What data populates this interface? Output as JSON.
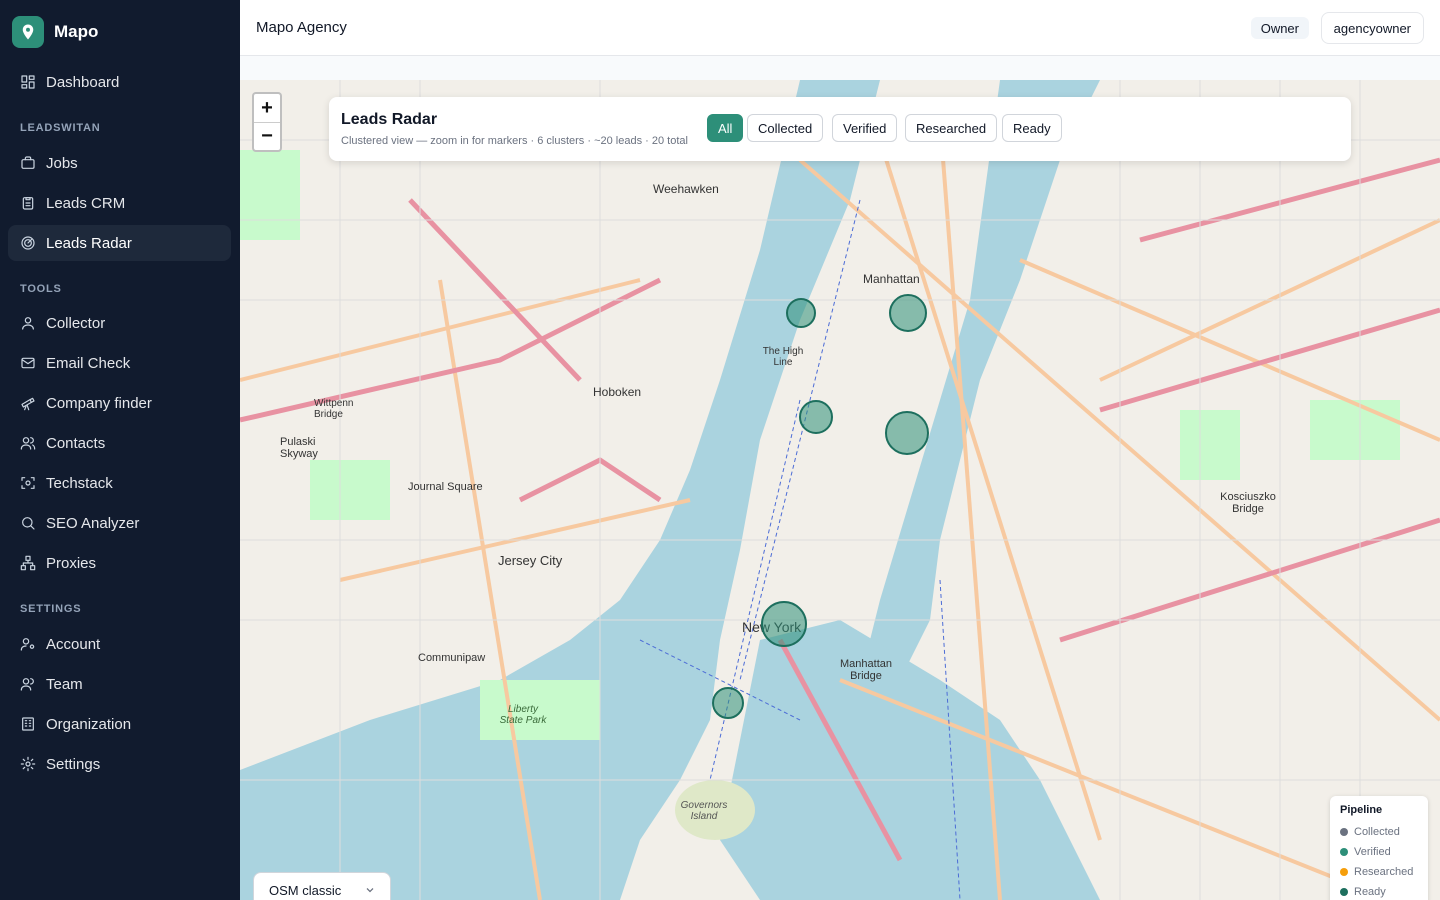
{
  "brand": {
    "name": "Mapo"
  },
  "sidebar": {
    "dashboard": "Dashboard",
    "section_leadswitan": "LEADSWITAN",
    "jobs": "Jobs",
    "leads_crm": "Leads CRM",
    "leads_radar": "Leads Radar",
    "section_tools": "TOOLS",
    "collector": "Collector",
    "email_check": "Email Check",
    "company_finder": "Company finder",
    "contacts": "Contacts",
    "techstack": "Techstack",
    "seo_analyzer": "SEO Analyzer",
    "proxies": "Proxies",
    "section_settings": "SETTINGS",
    "account": "Account",
    "team": "Team",
    "organization": "Organization",
    "settings": "Settings"
  },
  "header": {
    "agency": "Mapo Agency",
    "role": "Owner",
    "user": "agencyowner"
  },
  "radar": {
    "title": "Leads Radar",
    "subtitle": "Clustered view — zoom in for markers · 6 clusters · ~20 leads · 20 total",
    "filters": {
      "all": "All",
      "collected": "Collected",
      "verified": "Verified",
      "researched": "Researched",
      "ready": "Ready"
    }
  },
  "zoom": {
    "in": "+",
    "out": "−"
  },
  "legend": {
    "title": "Pipeline",
    "collected": "Collected",
    "verified": "Verified",
    "researched": "Researched",
    "ready": "Ready",
    "colors": {
      "collected": "#6b7280",
      "verified": "#2d8f79",
      "researched": "#f59e0b",
      "ready": "#1d6f5e"
    }
  },
  "map_labels": {
    "weehawken": "Weehawken",
    "manhattan": "Manhattan",
    "hoboken": "Hoboken",
    "jersey_city": "Jersey City",
    "journal_square": "Journal Square",
    "new_york": "New York",
    "communipaw": "Communipaw",
    "manhattan_bridge": "Manhattan Bridge",
    "kosciuszko_bridge": "Kosciuszko Bridge",
    "governors_island": "Governors Island",
    "liberty_state_park": "Liberty State Park",
    "pulaski_skyway": "Pulaski Skyway",
    "the_high_line": "The High Line",
    "wittpenn_bridge": "Wittpenn Bridge"
  },
  "layer": {
    "selected": "OSM classic"
  },
  "accent": "#2d8f79"
}
